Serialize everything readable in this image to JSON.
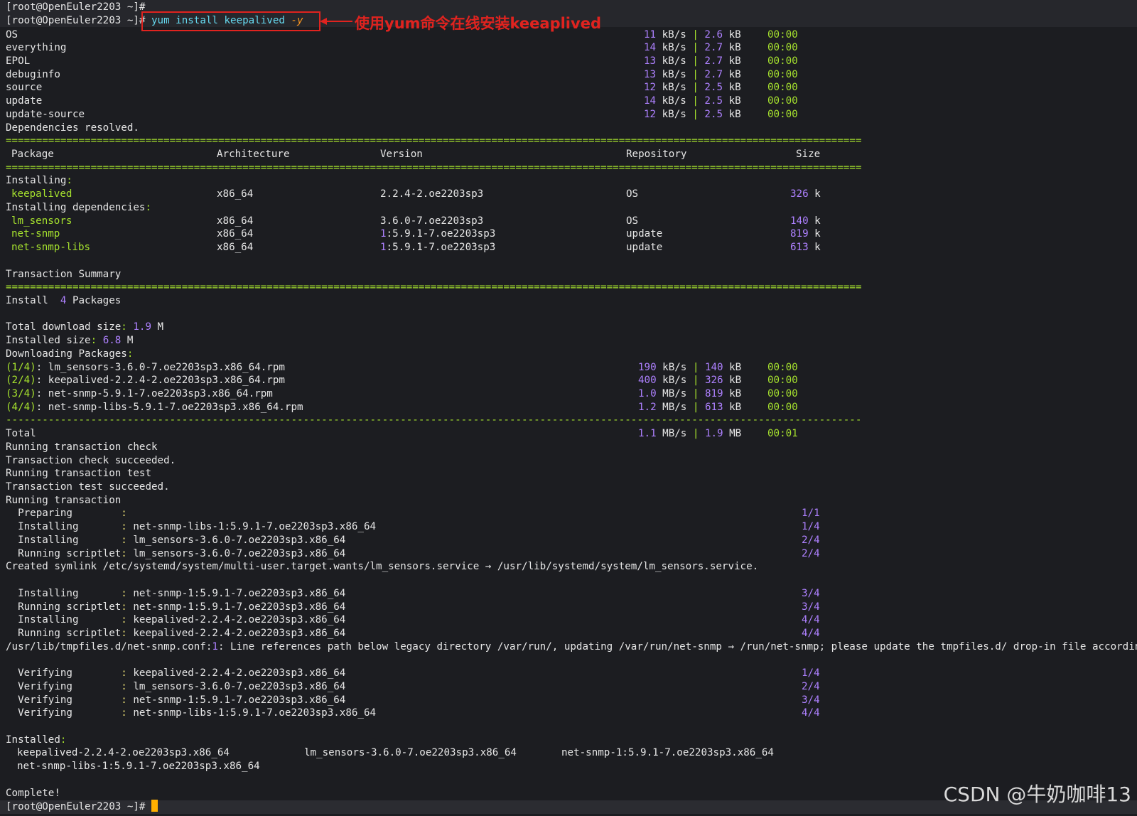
{
  "prompt": "[root@OpenEuler2203 ~]#",
  "command": {
    "text": "yum install keepalived ",
    "flag": "-y"
  },
  "annotation": {
    "label": "使用yum命令在线安装keeaplived",
    "color": "#e0231f"
  },
  "repos": [
    {
      "name": "OS",
      "speed": "11",
      "size": "2.6",
      "time": "00:00"
    },
    {
      "name": "everything",
      "speed": "14",
      "size": "2.7",
      "time": "00:00"
    },
    {
      "name": "EPOL",
      "speed": "13",
      "size": "2.7",
      "time": "00:00"
    },
    {
      "name": "debuginfo",
      "speed": "13",
      "size": "2.7",
      "time": "00:00"
    },
    {
      "name": "source",
      "speed": "12",
      "size": "2.5",
      "time": "00:00"
    },
    {
      "name": "update",
      "speed": "14",
      "size": "2.5",
      "time": "00:00"
    },
    {
      "name": "update-source",
      "speed": "12",
      "size": "2.5",
      "time": "00:00"
    }
  ],
  "deps_resolved": "Dependencies resolved.",
  "table_header": {
    "package": "Package",
    "arch": "Architecture",
    "version": "Version",
    "repo": "Repository",
    "size": "Size"
  },
  "installing_label": "Installing:",
  "installing": [
    {
      "name": "keepalived",
      "arch": "x86_64",
      "ver_epoch": "",
      "version": "2.2.4-2.oe2203sp3",
      "repo": "OS",
      "size": "326",
      "unit": "k"
    }
  ],
  "deps_label": "Installing dependencies:",
  "deps": [
    {
      "name": "lm_sensors",
      "arch": "x86_64",
      "ver_epoch": "",
      "version": "3.6.0-7.oe2203sp3",
      "repo": "OS",
      "size": "140",
      "unit": "k"
    },
    {
      "name": "net-snmp",
      "arch": "x86_64",
      "ver_epoch": "1",
      "version": ":5.9.1-7.oe2203sp3",
      "repo": "update",
      "size": "819",
      "unit": "k"
    },
    {
      "name": "net-snmp-libs",
      "arch": "x86_64",
      "ver_epoch": "1",
      "version": ":5.9.1-7.oe2203sp3",
      "repo": "update",
      "size": "613",
      "unit": "k"
    }
  ],
  "summary": {
    "title": "Transaction Summary",
    "install_word": "Install",
    "count": "4",
    "packages_word": "Packages",
    "total_dl_label": "Total download size:",
    "total_dl_value": "1.9",
    "total_dl_unit": "M",
    "installed_label": "Installed size:",
    "installed_value": "6.8",
    "installed_unit": "M",
    "downloading": "Downloading Packages:"
  },
  "downloads": [
    {
      "idx": "(1/4)",
      "file": "lm_sensors-3.6.0-7.oe2203sp3.x86_64.rpm",
      "speed": "190",
      "speed_unit": "kB/s",
      "size": "140",
      "size_unit": "kB",
      "time": "00:00"
    },
    {
      "idx": "(2/4)",
      "file": "keepalived-2.2.4-2.oe2203sp3.x86_64.rpm",
      "speed": "400",
      "speed_unit": "kB/s",
      "size": "326",
      "size_unit": "kB",
      "time": "00:00"
    },
    {
      "idx": "(3/4)",
      "file": "net-snmp-5.9.1-7.oe2203sp3.x86_64.rpm",
      "speed": "1.0",
      "speed_unit": "MB/s",
      "size": "819",
      "size_unit": "kB",
      "time": "00:00"
    },
    {
      "idx": "(4/4)",
      "file": "net-snmp-libs-5.9.1-7.oe2203sp3.x86_64.rpm",
      "speed": "1.2",
      "speed_unit": "MB/s",
      "size": "613",
      "size_unit": "kB",
      "time": "00:00"
    }
  ],
  "total": {
    "label": "Total",
    "speed": "1.1",
    "speed_unit": "MB/s",
    "size": "1.9",
    "size_unit": "MB",
    "time": "00:01"
  },
  "txn_lines": [
    "Running transaction check",
    "Transaction check succeeded.",
    "Running transaction test",
    "Transaction test succeeded.",
    "Running transaction"
  ],
  "steps_a": [
    {
      "action": "  Preparing        ",
      "pkg": "",
      "prog": "1/1"
    },
    {
      "action": "  Installing       ",
      "pkg": "net-snmp-libs-1:5.9.1-7.oe2203sp3.x86_64",
      "prog": "1/4"
    },
    {
      "action": "  Installing       ",
      "pkg": "lm_sensors-3.6.0-7.oe2203sp3.x86_64",
      "prog": "2/4"
    },
    {
      "action": "  Running scriptlet",
      "pkg": "lm_sensors-3.6.0-7.oe2203sp3.x86_64",
      "prog": "2/4"
    }
  ],
  "symlink": "Created symlink /etc/systemd/system/multi-user.target.wants/lm_sensors.service → /usr/lib/systemd/system/lm_sensors.service.",
  "steps_b": [
    {
      "action": "  Installing       ",
      "pkg": "net-snmp-1:5.9.1-7.oe2203sp3.x86_64",
      "prog": "3/4"
    },
    {
      "action": "  Running scriptlet",
      "pkg": "net-snmp-1:5.9.1-7.oe2203sp3.x86_64",
      "prog": "3/4"
    },
    {
      "action": "  Installing       ",
      "pkg": "keepalived-2.2.4-2.oe2203sp3.x86_64",
      "prog": "4/4"
    },
    {
      "action": "  Running scriptlet",
      "pkg": "keepalived-2.2.4-2.oe2203sp3.x86_64",
      "prog": "4/4"
    }
  ],
  "tmpfiles": {
    "path": "/usr/lib/tmpfiles.d/net-snmp.conf:",
    "num": "1",
    "msg": ": Line references path below legacy directory /var/run/, updating /var/run/net-snmp → /run/net-snmp; please update the tmpfiles.d/ drop-in file accordingly."
  },
  "verify": [
    {
      "action": "  Verifying        ",
      "pkg": "keepalived-2.2.4-2.oe2203sp3.x86_64",
      "prog": "1/4"
    },
    {
      "action": "  Verifying        ",
      "pkg": "lm_sensors-3.6.0-7.oe2203sp3.x86_64",
      "prog": "2/4"
    },
    {
      "action": "  Verifying        ",
      "pkg": "net-snmp-1:5.9.1-7.oe2203sp3.x86_64",
      "prog": "3/4"
    },
    {
      "action": "  Verifying        ",
      "pkg": "net-snmp-libs-1:5.9.1-7.oe2203sp3.x86_64",
      "prog": "4/4"
    }
  ],
  "installed_label": "Installed:",
  "installed_pkgs": [
    "keepalived-2.2.4-2.oe2203sp3.x86_64",
    "lm_sensors-3.6.0-7.oe2203sp3.x86_64",
    "net-snmp-1:5.9.1-7.oe2203sp3.x86_64",
    "net-snmp-libs-1:5.9.1-7.oe2203sp3.x86_64"
  ],
  "complete": "Complete!",
  "watermark": "CSDN @牛奶咖啡13"
}
